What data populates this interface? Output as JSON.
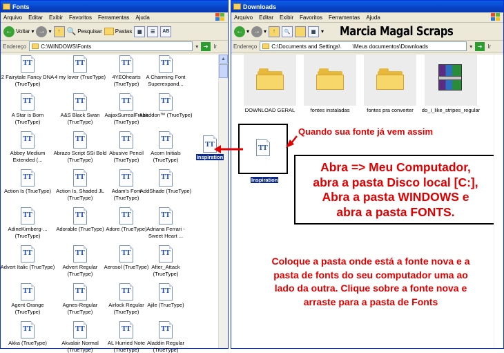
{
  "left_window": {
    "title": "Fonts",
    "menu": [
      "Arquivo",
      "Editar",
      "Exibir",
      "Favoritos",
      "Ferramentas",
      "Ajuda"
    ],
    "toolbar": {
      "back": "Voltar",
      "search": "Pesquisar",
      "folders": "Pastas"
    },
    "address_label": "Endereço",
    "address_value": "C:\\WINDOWS\\Fonts",
    "go": "Ir",
    "fonts": [
      [
        "2 Fairytale Fancy DNA (TrueType)",
        "4 my lover (TrueType)",
        "4YEOhearts (TrueType)",
        "A Charming Font Superexpand..."
      ],
      [
        "A Star is Born (TrueType)",
        "A&S Black Swan (TrueType)",
        "AajaxSurrealFreak (TrueType)",
        "Abaddon™ (TrueType)"
      ],
      [
        "Abbey Medium Extended (...",
        "Abrazo Script SSi Bold (TrueType)",
        "Abusive Pencil (TrueType)",
        "Acorn Initials (TrueType)"
      ],
      [
        "Action Is (TrueType)",
        "Action Is, Shaded JL (TrueType)",
        "Adam's Font (TrueType)",
        "AddShade (TrueType)"
      ],
      [
        "AdineKirnberg-... (TrueType)",
        "Adorable (TrueType)",
        "Adore (TrueType)",
        "Adriana Ferrari - Sweet Heart ..."
      ],
      [
        "Advert Italic (TrueType)",
        "Advert Regular (TrueType)",
        "Aerosol (TrueType)",
        "After_Attack (TrueType)"
      ],
      [
        "Agent Orange (TrueType)",
        "Agnes-Regular (TrueType)",
        "Airlock Regular (TrueType)",
        "Ajile (TrueType)"
      ],
      [
        "Akka (TrueType)",
        "Akvalair Normal (TrueType)",
        "AL Hurried Note (TrueType)",
        "Aladdin Regular (TrueType)"
      ]
    ]
  },
  "right_window": {
    "title": "Downloads",
    "menu": [
      "Arquivo",
      "Editar",
      "Exibir",
      "Favoritos",
      "Ferramentas",
      "Ajuda"
    ],
    "address_label": "Endereço",
    "address_value": "C:\\Documents and Settings\\        \\Meus documentos\\Downloads",
    "go": "Ir",
    "folders": [
      "DOWNLOAD GERAL",
      "fontes instaladas",
      "fontes pra converter",
      "do_i_like_stripes_regular"
    ],
    "inspiration_label": "Inspiration"
  },
  "dragged_icon_label": "Inspiration",
  "watermark": "Marcia Magal Scraps",
  "annotations": {
    "callout": "Quando sua fonte já vem assim",
    "instructions": [
      "Abra => Meu Computador,",
      "abra a pasta Disco local [C:],",
      "Abra a pasta WINDOWS e",
      "abra a pasta FONTS."
    ],
    "drag_tip": [
      "Coloque a pasta onde está a fonte nova e a",
      "pasta de fonts do seu computador uma ao",
      "lado da outra. Clique sobre a fonte nova e",
      "arraste para a pasta de Fonts"
    ]
  },
  "colors": {
    "annotation_red": "#e00000",
    "titlebar_blue": "#0a5fe8",
    "font_icon_blue": "#1f4fb7"
  },
  "icons": [
    "folder-icon",
    "winrar-archive-icon",
    "truetype-font-icon",
    "back-arrow-icon",
    "forward-arrow-icon",
    "up-folder-icon",
    "search-icon",
    "folders-icon",
    "go-arrow-icon"
  ]
}
